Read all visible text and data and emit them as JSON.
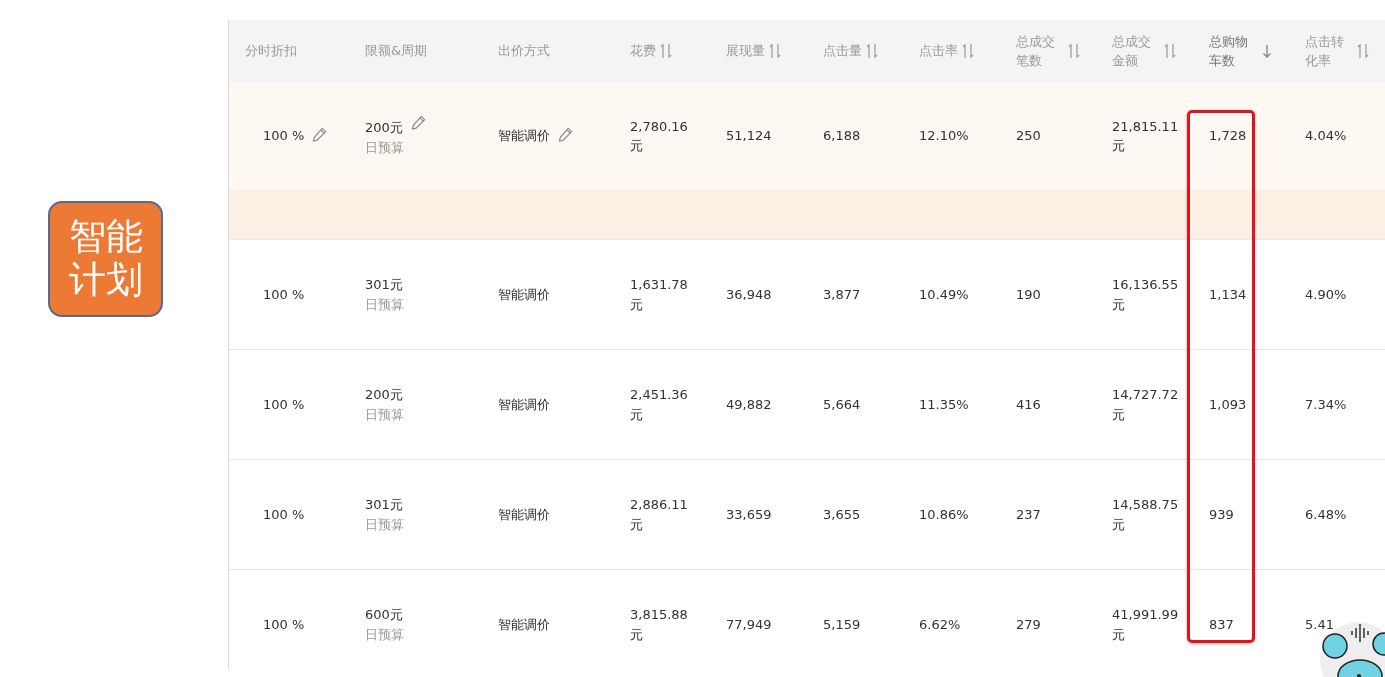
{
  "badge": {
    "text": "智能计划"
  },
  "table": {
    "columns": [
      {
        "label": "分时折扣",
        "sortable": false,
        "sorted": false,
        "highlighted": false
      },
      {
        "label": "限额&周期",
        "sortable": false,
        "sorted": false,
        "highlighted": false
      },
      {
        "label": "出价方式",
        "sortable": false,
        "sorted": false,
        "highlighted": false
      },
      {
        "label": "花费",
        "sortable": true,
        "sorted": false,
        "highlighted": false
      },
      {
        "label": "展现量",
        "sortable": true,
        "sorted": false,
        "highlighted": false
      },
      {
        "label": "点击量",
        "sortable": true,
        "sorted": false,
        "highlighted": false
      },
      {
        "label": "点击率",
        "sortable": true,
        "sorted": false,
        "highlighted": false
      },
      {
        "label": "总成交笔数",
        "sortable": true,
        "sorted": false,
        "highlighted": false
      },
      {
        "label": "总成交金额",
        "sortable": true,
        "sorted": false,
        "highlighted": false
      },
      {
        "label": "总购物车数",
        "sortable": true,
        "sorted": true,
        "highlighted": true
      },
      {
        "label": "点击转化率",
        "sortable": true,
        "sorted": false,
        "highlighted": false
      }
    ],
    "rows": [
      {
        "kind": "data",
        "selected": true,
        "editable": true,
        "discount": "100 %",
        "budget": "200元",
        "budget_type": "日预算",
        "bid": "智能调价",
        "cost": "2,780.16元",
        "impressions": "51,124",
        "clicks": "6,188",
        "ctr": "12.10%",
        "orders": "250",
        "revenue": "21,815.11元",
        "carts": "1,728",
        "cvr": "4.04%"
      },
      {
        "kind": "spacer"
      },
      {
        "kind": "data",
        "selected": false,
        "editable": false,
        "discount": "100 %",
        "budget": "301元",
        "budget_type": "日预算",
        "bid": "智能调价",
        "cost": "1,631.78元",
        "impressions": "36,948",
        "clicks": "3,877",
        "ctr": "10.49%",
        "orders": "190",
        "revenue": "16,136.55元",
        "carts": "1,134",
        "cvr": "4.90%"
      },
      {
        "kind": "data",
        "selected": false,
        "editable": false,
        "discount": "100 %",
        "budget": "200元",
        "budget_type": "日预算",
        "bid": "智能调价",
        "cost": "2,451.36元",
        "impressions": "49,882",
        "clicks": "5,664",
        "ctr": "11.35%",
        "orders": "416",
        "revenue": "14,727.72元",
        "carts": "1,093",
        "cvr": "7.34%"
      },
      {
        "kind": "data",
        "selected": false,
        "editable": false,
        "discount": "100 %",
        "budget": "301元",
        "budget_type": "日预算",
        "bid": "智能调价",
        "cost": "2,886.11元",
        "impressions": "33,659",
        "clicks": "3,655",
        "ctr": "10.86%",
        "orders": "237",
        "revenue": "14,588.75元",
        "carts": "939",
        "cvr": "6.48%"
      },
      {
        "kind": "data",
        "selected": false,
        "editable": false,
        "discount": "100 %",
        "budget": "600元",
        "budget_type": "日预算",
        "bid": "智能调价",
        "cost": "3,815.88元",
        "impressions": "77,949",
        "clicks": "5,159",
        "ctr": "6.62%",
        "orders": "279",
        "revenue": "41,991.99元",
        "carts": "837",
        "cvr": "5.41"
      }
    ]
  }
}
